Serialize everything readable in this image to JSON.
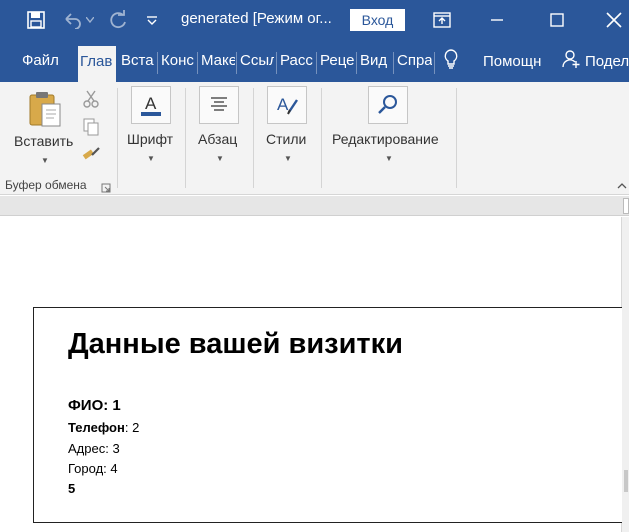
{
  "window": {
    "title": "generated [Режим ог...",
    "sign_in_label": "Вход"
  },
  "tabs": [
    {
      "label": "Файл"
    },
    {
      "label": "Глав"
    },
    {
      "label": "Вста"
    },
    {
      "label": "Конс"
    },
    {
      "label": "Маке"
    },
    {
      "label": "Ссыл"
    },
    {
      "label": "Расс"
    },
    {
      "label": "Реце"
    },
    {
      "label": "Вид"
    },
    {
      "label": "Спра"
    }
  ],
  "tell_me": {
    "label": "Помощн"
  },
  "share": {
    "label": "Подел"
  },
  "ribbon": {
    "paste_label": "Вставить",
    "clipboard_group_label": "Буфер обмена",
    "font_label": "Шрифт",
    "paragraph_label": "Абзац",
    "styles_label": "Стили",
    "editing_label": "Редактирование"
  },
  "document": {
    "title": "Данные вашей визитки",
    "fio": "ФИО: 1",
    "phone_label": "Телефон",
    "phone_value": ": 2",
    "address": "Адрес: 3",
    "city": "Город: 4",
    "extra": "5"
  },
  "colors": {
    "accent": "#2b579a",
    "ribbon_bg": "#f3f3f3"
  }
}
